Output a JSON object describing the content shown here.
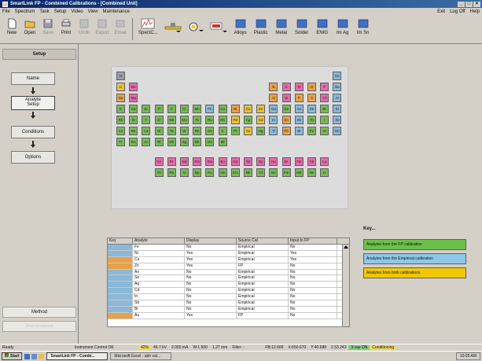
{
  "window": {
    "title": "SmartLink FP - Combined Calibrations - [Combined Unit]",
    "min": "_",
    "max": "□",
    "close": "×"
  },
  "menu": {
    "items": [
      "File",
      "Spectrum",
      "Task",
      "Setup",
      "Video",
      "View",
      "Maintenance"
    ],
    "right": [
      "Exit",
      "Log Off",
      "Help"
    ]
  },
  "toolbar": {
    "file_buttons": [
      {
        "label": "New",
        "disabled": false
      },
      {
        "label": "Open",
        "disabled": false
      },
      {
        "label": "Save",
        "disabled": true
      },
      {
        "label": "Print",
        "disabled": false
      },
      {
        "label": "Undo",
        "disabled": true
      },
      {
        "label": "Export",
        "disabled": true
      },
      {
        "label": "Email",
        "disabled": true
      }
    ],
    "spectrum_label": "SpectC...",
    "apps": [
      "Alloys",
      "Plastic",
      "Metal",
      "Solder",
      "ENIG",
      "Im Ag",
      "Im Sn"
    ]
  },
  "sidebar": {
    "setup_label": "Setup",
    "steps": [
      "Name",
      "Analyte Setup",
      "Conditions",
      "Options"
    ],
    "method_label": "Method",
    "method2_label": "Maintenance"
  },
  "periodic_table": {
    "rows": [
      [
        [
          "H",
          "gray"
        ],
        [
          "He",
          "blue"
        ]
      ],
      [
        [
          "Li",
          "yellow"
        ],
        [
          "Be",
          "pink"
        ],
        [
          "B",
          "orange"
        ],
        [
          "C",
          "pink"
        ],
        [
          "N",
          "pink"
        ],
        [
          "O",
          "orange"
        ],
        [
          "F",
          "pink"
        ],
        [
          "Ne",
          "blue"
        ]
      ],
      [
        [
          "Na",
          "orange"
        ],
        [
          "Mg",
          "pink"
        ],
        [
          "Al",
          "orange"
        ],
        [
          "Si",
          "pink"
        ],
        [
          "P",
          "orange"
        ],
        [
          "S",
          "orange"
        ],
        [
          "Cl",
          "pink"
        ],
        [
          "Ar",
          "blue"
        ]
      ],
      [
        [
          "K",
          "green"
        ],
        [
          "Ca",
          "green"
        ],
        [
          "Sc",
          "green"
        ],
        [
          "Ti",
          "green"
        ],
        [
          "V",
          "green"
        ],
        [
          "Cr",
          "green"
        ],
        [
          "Mn",
          "green"
        ],
        [
          "Fe",
          "blue"
        ],
        [
          "Co",
          "green"
        ],
        [
          "Ni",
          "orange"
        ],
        [
          "Cu",
          "yellow"
        ],
        [
          "Zn",
          "yellow"
        ],
        [
          "Ga",
          "blue"
        ],
        [
          "Ge",
          "green"
        ],
        [
          "As",
          "blue"
        ],
        [
          "Se",
          "blue"
        ],
        [
          "Br",
          "green"
        ],
        [
          "Kr",
          "blue"
        ]
      ],
      [
        [
          "Rb",
          "green"
        ],
        [
          "Sr",
          "green"
        ],
        [
          "Y",
          "green"
        ],
        [
          "Zr",
          "green"
        ],
        [
          "Nb",
          "green"
        ],
        [
          "Mo",
          "green"
        ],
        [
          "Tc",
          "green"
        ],
        [
          "Ru",
          "green"
        ],
        [
          "Rh",
          "green"
        ],
        [
          "Pd",
          "yellow"
        ],
        [
          "Ag",
          "green"
        ],
        [
          "Cd",
          "yellow"
        ],
        [
          "In",
          "blue"
        ],
        [
          "Sn",
          "orange"
        ],
        [
          "Sb",
          "blue"
        ],
        [
          "Te",
          "green"
        ],
        [
          "I",
          "green"
        ],
        [
          "Xe",
          "blue"
        ]
      ],
      [
        [
          "Cs",
          "green"
        ],
        [
          "Ba",
          "green"
        ],
        [
          "La",
          "green"
        ],
        [
          "Hf",
          "green"
        ],
        [
          "Ta",
          "green"
        ],
        [
          "W",
          "green"
        ],
        [
          "Re",
          "green"
        ],
        [
          "Os",
          "green"
        ],
        [
          "Ir",
          "green"
        ],
        [
          "Pt",
          "green"
        ],
        [
          "Au",
          "yellow"
        ],
        [
          "Hg",
          "green"
        ],
        [
          "Tl",
          "blue"
        ],
        [
          "Pb",
          "orange"
        ],
        [
          "Bi",
          "blue"
        ],
        [
          "Po",
          "green"
        ],
        [
          "At",
          "green"
        ],
        [
          "Rn",
          "blue"
        ]
      ],
      [
        [
          "Fr",
          "green"
        ],
        [
          "Ra",
          "green"
        ],
        [
          "Ac",
          "green"
        ],
        [
          "Rf",
          "green"
        ],
        [
          "Db",
          "green"
        ],
        [
          "Sg",
          "green"
        ],
        [
          "Bh",
          "green"
        ],
        [
          "Hs",
          "green"
        ],
        [
          "Mt",
          "green"
        ]
      ]
    ],
    "lanthanides": [
      "Ce",
      "Pr",
      "Nd",
      "Pm",
      "Sm",
      "Eu",
      "Gd",
      "Tb",
      "Dy",
      "Ho",
      "Er",
      "Tm",
      "Yb",
      "Lu"
    ],
    "actinides": [
      "Th",
      "Pa",
      "U",
      "Np",
      "Pu",
      "Am",
      "Cm",
      "Bk",
      "Cf",
      "Es",
      "Fm",
      "Md",
      "No",
      "Lr"
    ]
  },
  "grid": {
    "headers": [
      "Key",
      "Analyte",
      "Display",
      "Source Cal",
      "Input to FP"
    ],
    "rows": [
      {
        "key": "blue",
        "analyte": "Fe",
        "display": "No",
        "source": "Empirical",
        "input": "No"
      },
      {
        "key": "blue",
        "analyte": "Ni",
        "display": "Yes",
        "source": "Empirical",
        "input": "Yes"
      },
      {
        "key": "orange",
        "analyte": "Cu",
        "display": "Yes",
        "source": "Empirical",
        "input": "Yes"
      },
      {
        "key": "orange",
        "analyte": "Zn",
        "display": "Yes",
        "source": "FP",
        "input": "No"
      },
      {
        "key": "blue",
        "analyte": "As",
        "display": "No",
        "source": "Empirical",
        "input": "No"
      },
      {
        "key": "blue",
        "analyte": "Se",
        "display": "No",
        "source": "Empirical",
        "input": "No"
      },
      {
        "key": "blue",
        "analyte": "Ag",
        "display": "No",
        "source": "Empirical",
        "input": "No"
      },
      {
        "key": "blue",
        "analyte": "Cd",
        "display": "No",
        "source": "Empirical",
        "input": "No"
      },
      {
        "key": "blue",
        "analyte": "In",
        "display": "No",
        "source": "Empirical",
        "input": "No"
      },
      {
        "key": "blue",
        "analyte": "Sb",
        "display": "No",
        "source": "Empirical",
        "input": "No"
      },
      {
        "key": "blue",
        "analyte": "Bi",
        "display": "No",
        "source": "Empirical",
        "input": "No"
      },
      {
        "key": "orange",
        "analyte": "Au",
        "display": "Yes",
        "source": "FP",
        "input": "No"
      }
    ]
  },
  "key_legend": {
    "title": "Key...",
    "items": [
      {
        "label": "Analytes from the FP calibration",
        "color": "#6cc04a"
      },
      {
        "label": "Analytes from the Empirical calibration",
        "color": "#8ec8e8"
      },
      {
        "label": "Analytes from both calibrations",
        "color": "#f0c800"
      }
    ]
  },
  "colors": {
    "yellow": "#e8c23a",
    "orange": "#e8a148",
    "pink": "#e46aa8",
    "green": "#78b858",
    "blue": "#8ab8d8",
    "gray": "#9a9aa8"
  },
  "status": {
    "ready": "Ready",
    "control": "Instrument Control OK",
    "pct": "42%",
    "kv": "46.7 kV",
    "ma": "2.000 mA",
    "w": "W:1.500",
    "mm": "1.27 mm",
    "filter": "Filter: -",
    "fb": "FB:12.609",
    "x": "X:650.670",
    "y": "Y:40.688",
    "t": "2:33.243",
    "xray": "X-ray ON",
    "cond": "Conditioning"
  },
  "taskbar": {
    "start": "Start",
    "tasks": [
      "SmartLink FP - Combi...",
      "Microsoft Excel - abh val..."
    ],
    "time": "10:05 AM"
  }
}
